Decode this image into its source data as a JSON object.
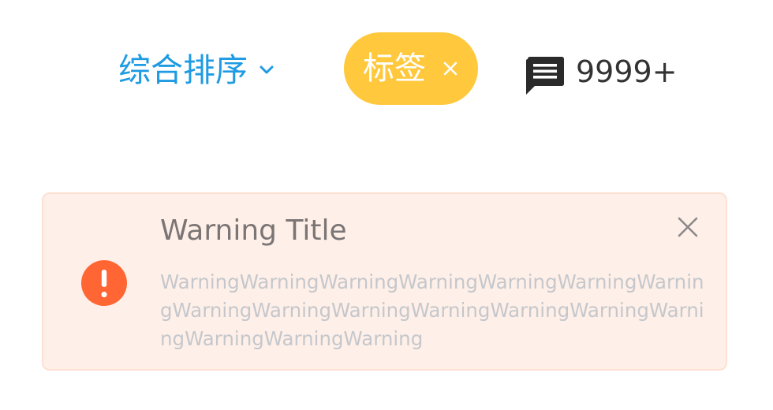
{
  "toolbar": {
    "sort": {
      "label": "综合排序",
      "icon": "chevron-down-icon",
      "color": "#1e9be3"
    },
    "tag": {
      "label": "标签",
      "close_icon": "close-icon",
      "color": "#ffc83d"
    },
    "comments": {
      "icon": "chat-bubble-icon",
      "count": "9999+"
    }
  },
  "alert": {
    "type": "warning",
    "title": "Warning Title",
    "message": "WarningWarningWarningWarningWarningWarningWarningWarningWarningWarningWarningWarningWarningWarningWarningWarningWarning",
    "icon": "exclamation-circle-icon",
    "close_icon": "close-icon",
    "icon_color": "#ff6633",
    "background": "#fef0e8",
    "border_color": "#fde0d2"
  }
}
